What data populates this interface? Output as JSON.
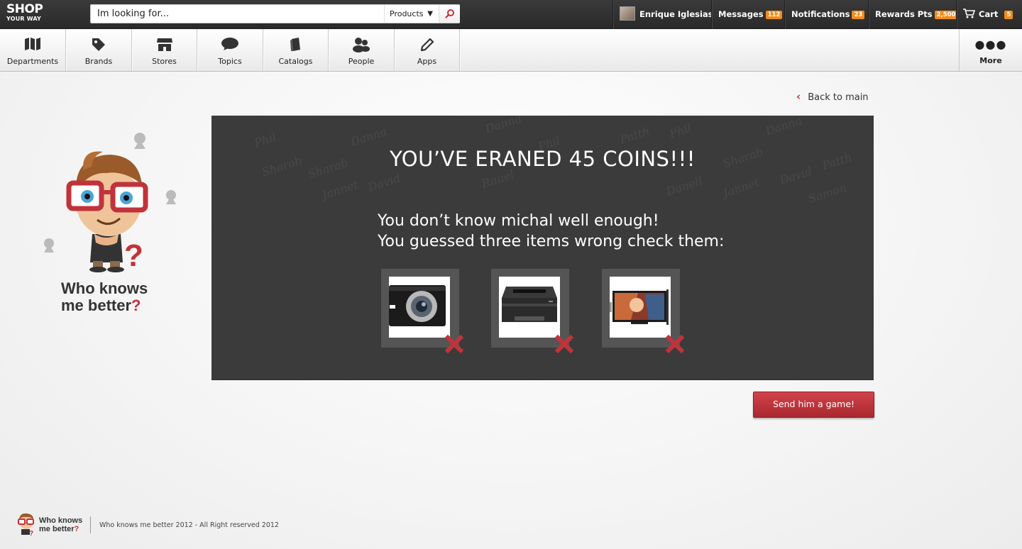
{
  "topbar": {
    "logo": {
      "line1": "SHOP",
      "line2": "YOUR WAY"
    },
    "search": {
      "placeholder": "Im looking for...",
      "category": "Products"
    },
    "user": {
      "name": "Enrique Iglesias"
    },
    "messages": {
      "label": "Messages",
      "count": "112"
    },
    "notifications": {
      "label": "Notifications",
      "count": "23"
    },
    "rewards": {
      "label": "Rewards Pts",
      "count": "2,500"
    },
    "cart": {
      "label": "Cart",
      "count": "5"
    },
    "badge_color": "#f28c1a"
  },
  "nav": {
    "items": [
      {
        "label": "Departments",
        "icon": "map-icon"
      },
      {
        "label": "Brands",
        "icon": "tag-icon"
      },
      {
        "label": "Stores",
        "icon": "store-icon"
      },
      {
        "label": "Topics",
        "icon": "speech-bubble-icon"
      },
      {
        "label": "Catalogs",
        "icon": "catalog-icon"
      },
      {
        "label": "People",
        "icon": "people-icon"
      },
      {
        "label": "Apps",
        "icon": "pencil-icon"
      }
    ],
    "more": {
      "label": "More",
      "icon": "more-dots-icon"
    }
  },
  "back": {
    "label": "Back to main"
  },
  "brand": {
    "line1": "Who knows",
    "line2": "me better",
    "mark": "?"
  },
  "result": {
    "title": "YOU’VE ERANED 45 COINS!!!",
    "line1": "You don’t know michal well enough!",
    "line2": "You guessed three items wrong check them:",
    "items": [
      {
        "name": "camera",
        "status": "wrong"
      },
      {
        "name": "printer",
        "status": "wrong"
      },
      {
        "name": "tv",
        "status": "wrong"
      }
    ],
    "accent": "#c0333a"
  },
  "send_button": {
    "label": "Send him a game!"
  },
  "footer": {
    "brand_line1": "Who knows",
    "brand_line2": "me better",
    "brand_mark": "?",
    "copyright": "Who knows me better 2012 - All Right reserved 2012"
  }
}
